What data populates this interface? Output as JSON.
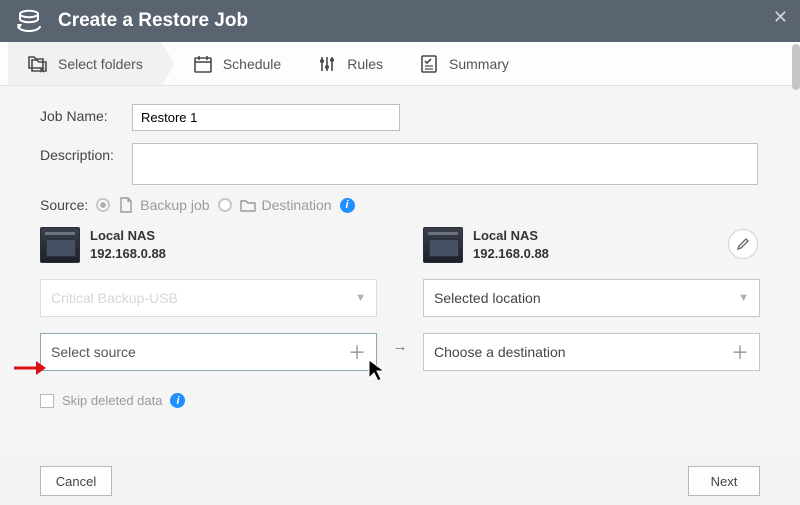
{
  "header": {
    "title": "Create a Restore Job"
  },
  "steps": [
    {
      "label": "Select folders",
      "active": true
    },
    {
      "label": "Schedule"
    },
    {
      "label": "Rules"
    },
    {
      "label": "Summary"
    }
  ],
  "labels": {
    "jobName": "Job Name:",
    "description": "Description:",
    "source": "Source:"
  },
  "form": {
    "jobNameValue": "Restore 1",
    "descriptionValue": ""
  },
  "sourceOptions": {
    "backupJob": "Backup job",
    "destination": "Destination"
  },
  "left": {
    "nasName": "Local NAS",
    "nasIp": "192.168.0.88",
    "pickerText": "Critical Backup-USB",
    "selectSource": "Select source",
    "skipDeleted": "Skip deleted data"
  },
  "right": {
    "nasName": "Local NAS",
    "nasIp": "192.168.0.88",
    "pickerText": "Selected location",
    "chooseDest": "Choose a destination"
  },
  "buttons": {
    "cancel": "Cancel",
    "next": "Next"
  }
}
